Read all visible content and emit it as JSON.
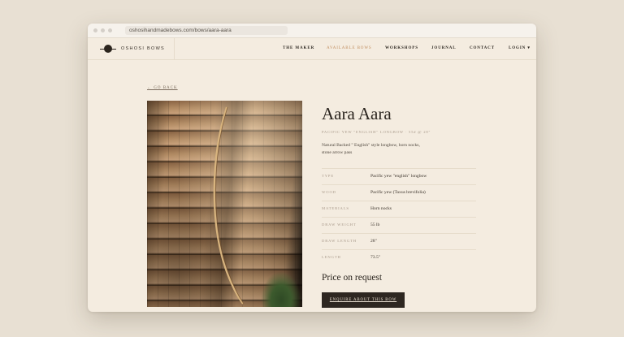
{
  "browser": {
    "url": "oshosihandmadebows.com/bows/aara-aara"
  },
  "nav": {
    "logo_text": "OSHOSI BOWS",
    "items": [
      {
        "label": "THE MAKER",
        "active": false
      },
      {
        "label": "AVAILABLE BOWS",
        "active": true
      },
      {
        "label": "WORKSHOPS",
        "active": false
      },
      {
        "label": "JOURNAL",
        "active": false
      },
      {
        "label": "CONTACT",
        "active": false
      },
      {
        "label": "LOGIN ▾",
        "active": false
      }
    ]
  },
  "page": {
    "back_label": "← GO BACK",
    "title": "Aara Aara",
    "subtitle": "PACIFIC YEW \"ENGLISH\" LONGBOW · 55# @ 28\"",
    "description": "Natural Backed \" English\" style longbow, horn nocks, stone arrow pass",
    "specs": [
      {
        "label": "TYPE",
        "value": "Pacific yew \"english\" longbow"
      },
      {
        "label": "WOOD",
        "value": "Pacific yew (Taxus brevifolia)"
      },
      {
        "label": "MATERIALS",
        "value": "Horn nocks"
      },
      {
        "label": "DRAW WEIGHT",
        "value": "55 lb"
      },
      {
        "label": "DRAW LENGTH",
        "value": "28\""
      },
      {
        "label": "LENGTH",
        "value": "73.5\""
      }
    ],
    "price": "Price on request",
    "enquire_label": "ENQUIRE ABOUT THIS BOW"
  },
  "colors": {
    "page_bg": "#e8e0d3",
    "content_bg": "#f4ece0",
    "accent": "#c08d5e",
    "button_bg": "#2e2721"
  },
  "icons": {
    "logo": "bow-logo-icon",
    "login_caret": "chevron-down-icon"
  }
}
